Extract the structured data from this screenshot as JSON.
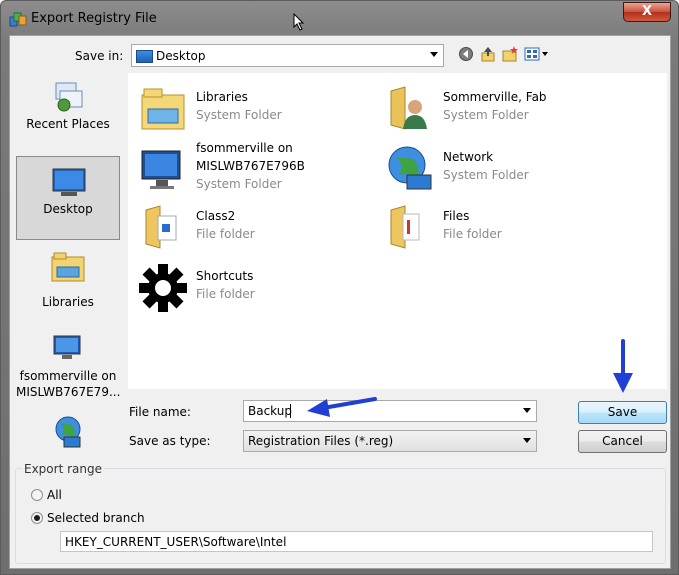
{
  "window": {
    "title": "Export Registry File",
    "close_label": "X"
  },
  "save_in": {
    "label": "Save in:",
    "value": "Desktop"
  },
  "toolbar_icons": [
    "back-icon",
    "up-folder-icon",
    "new-folder-icon",
    "view-menu-icon"
  ],
  "places": [
    {
      "id": "recent-places",
      "label": "Recent Places",
      "selected": false
    },
    {
      "id": "desktop",
      "label": "Desktop",
      "selected": true
    },
    {
      "id": "libraries",
      "label": "Libraries",
      "selected": false
    },
    {
      "id": "computer",
      "label": "fsommerville on MISLWB767E79...",
      "selected": false
    },
    {
      "id": "network",
      "label": "",
      "selected": false
    }
  ],
  "files": [
    {
      "name": "Libraries",
      "type": "System Folder",
      "icon": "libraries-icon"
    },
    {
      "name": "Sommerville, Fab",
      "type": "System Folder",
      "icon": "user-folder-icon"
    },
    {
      "name": "fsommerville on MISLWB767E796B",
      "type": "System Folder",
      "icon": "computer-icon"
    },
    {
      "name": "Network",
      "type": "System Folder",
      "icon": "network-icon"
    },
    {
      "name": "Class2",
      "type": "File folder",
      "icon": "folder-icon"
    },
    {
      "name": "Files",
      "type": "File folder",
      "icon": "folder-icon"
    },
    {
      "name": "Shortcuts",
      "type": "File folder",
      "icon": "gear-icon"
    }
  ],
  "file_name": {
    "label": "File name:",
    "value": "Backup"
  },
  "save_as_type": {
    "label": "Save as type:",
    "value": "Registration Files (*.reg)"
  },
  "buttons": {
    "save": "Save",
    "cancel": "Cancel"
  },
  "export_range": {
    "label": "Export range",
    "options": [
      {
        "label": "All",
        "selected": false
      },
      {
        "label": "Selected branch",
        "selected": true
      }
    ],
    "branch_value": "HKEY_CURRENT_USER\\Software\\Intel"
  },
  "colors": {
    "annotation_arrow": "#1f3fd6",
    "selection": "#d8d8d8"
  }
}
